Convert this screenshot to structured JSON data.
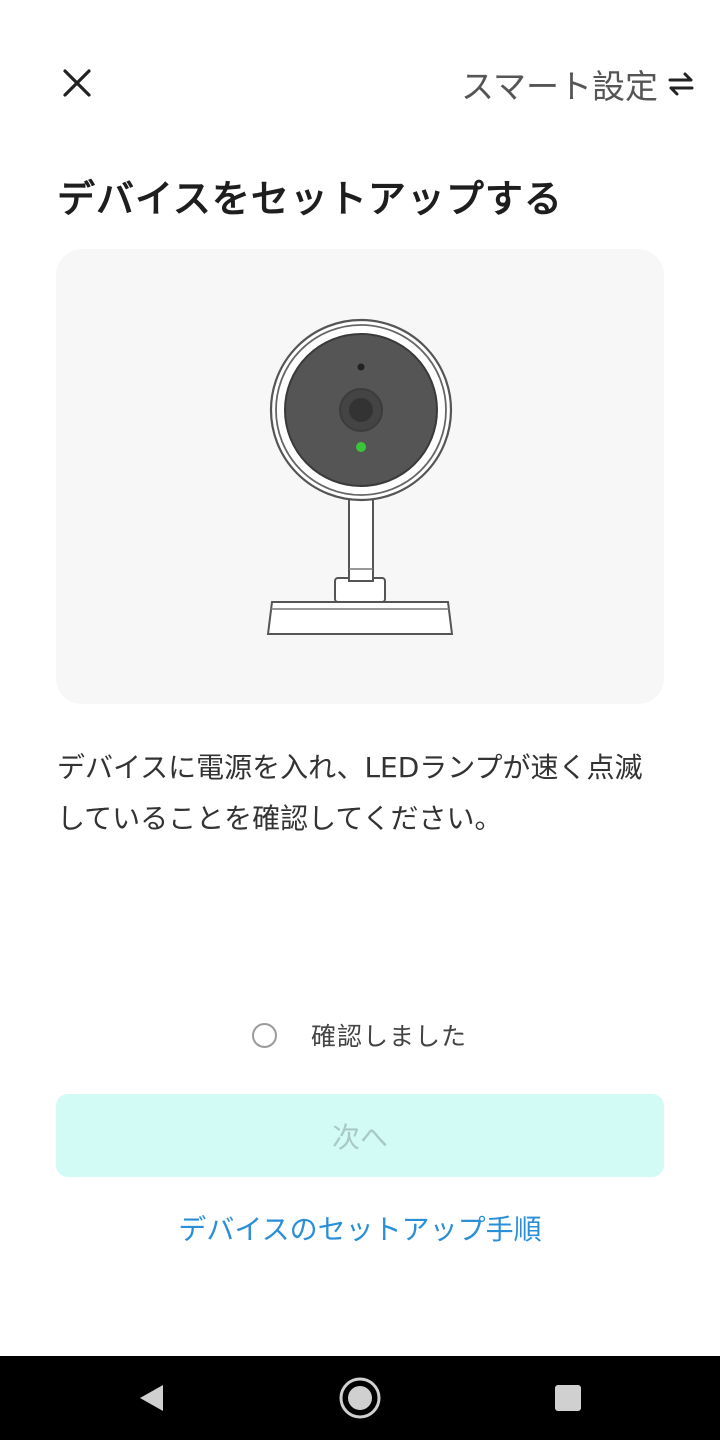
{
  "header": {
    "close_icon": "close-icon",
    "mode_label": "スマート設定",
    "mode_icon": "swap-icon"
  },
  "title": "デバイスをセットアップする",
  "illustration": {
    "subject": "camera-illustration",
    "led_color": "#3ac63a"
  },
  "description": "デバイスに電源を入れ、LEDランプが速く点滅していることを確認してください。",
  "confirm": {
    "label": "確認しました",
    "checked": false
  },
  "next_button": {
    "label": "次へ",
    "enabled": false
  },
  "guide_link": "デバイスのセットアップ手順",
  "nav": {
    "back_icon": "back-triangle-icon",
    "home_icon": "home-circle-icon",
    "recents_icon": "recents-square-icon"
  },
  "colors": {
    "accent_link": "#2b8fd8",
    "button_disabled_bg": "#d1fbf4",
    "button_disabled_text": "#a9c9c5"
  }
}
